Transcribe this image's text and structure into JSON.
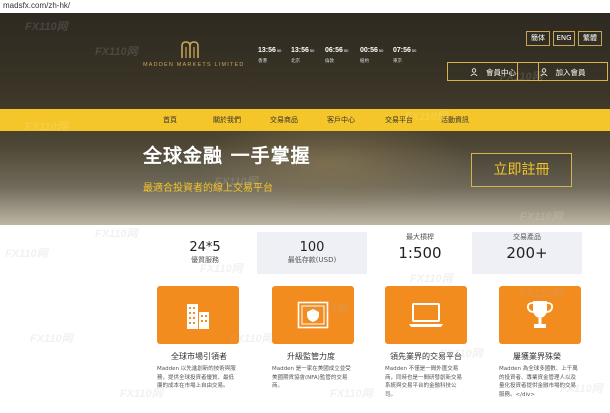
{
  "browser": {
    "url": "madsfx.com/zh-hk/"
  },
  "logo": {
    "text": "MADDEN MARKETS LIMITED"
  },
  "clocks": [
    {
      "time": "13:56",
      "sec": "50",
      "city": "香港"
    },
    {
      "time": "13:56",
      "sec": "50",
      "city": "北京"
    },
    {
      "time": "06:56",
      "sec": "50",
      "city": "倫敦"
    },
    {
      "time": "00:56",
      "sec": "50",
      "city": "紐約"
    },
    {
      "time": "07:56",
      "sec": "50",
      "city": "東京"
    }
  ],
  "languages": [
    "簡体",
    "ENG",
    "繁體"
  ],
  "member_buttons": {
    "member_center": "會員中心",
    "add_member": "加入會員"
  },
  "nav": [
    "首頁",
    "關於我們",
    "交易商品",
    "客戶中心",
    "交易平台",
    "活動資訊"
  ],
  "hero": {
    "slogan": "全球金融 一手掌握",
    "subtitle": "最適合投資者的線上交易平台",
    "register_label": "立即註冊"
  },
  "stats": [
    {
      "top": "",
      "big": "24*5",
      "small": "優質服務"
    },
    {
      "top": "",
      "big": "100",
      "small": "最低存款(USD)"
    },
    {
      "top": "最大槓桿",
      "big": "1:500",
      "small": ""
    },
    {
      "top": "交易產品",
      "big": "200+",
      "small": ""
    }
  ],
  "features": [
    {
      "icon": "building-icon",
      "title": "全球市場引領者",
      "desc": "Madden 以先進創新的技術與服務，提供全球投資者優質、最低廉的成本在市場上自由交易。"
    },
    {
      "icon": "certificate-icon",
      "title": "升級監管力度",
      "desc": "Madden 是一家在美國成立並受美國期貨協會(NFA)監管的交易商。"
    },
    {
      "icon": "laptop-icon",
      "title": "領先業界的交易平台",
      "desc": "Madden 不僅是一間外匯交易商，同時也是一間研發創新交易系統與交易平台的金融科技公司。"
    },
    {
      "icon": "trophy-icon",
      "title": "屢獲業界殊榮",
      "desc": "Madden 為全球多國數、上千萬的投資者、專業資金管理人以及量化投資者提供金融市場的交易服務。</div>"
    }
  ],
  "watermark": "FX110网"
}
